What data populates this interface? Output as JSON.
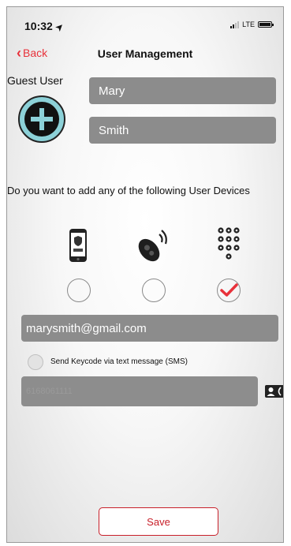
{
  "status_bar": {
    "time": "10:32",
    "network": "LTE"
  },
  "nav": {
    "back_label": "Back",
    "title": "User Management"
  },
  "guest": {
    "label": "Guest User",
    "first_name": "Mary",
    "last_name": "Smith"
  },
  "devices": {
    "question": "Do you want to add any of the following User Devices",
    "items": [
      {
        "name": "phone",
        "icon": "smartphone-icon",
        "selected": false
      },
      {
        "name": "fob",
        "icon": "key-fob-icon",
        "selected": false
      },
      {
        "name": "keypad",
        "icon": "keypad-icon",
        "selected": true
      }
    ]
  },
  "email": {
    "value": "marysmith@gmail.com"
  },
  "sms": {
    "label": "Send Keycode via text message (SMS)",
    "checked": false
  },
  "phone": {
    "value": "6168061111"
  },
  "actions": {
    "save_label": "Save"
  },
  "colors": {
    "accent": "#e8313a",
    "field_bg": "#8c8c8c",
    "add_button": "#8cd1d8"
  }
}
